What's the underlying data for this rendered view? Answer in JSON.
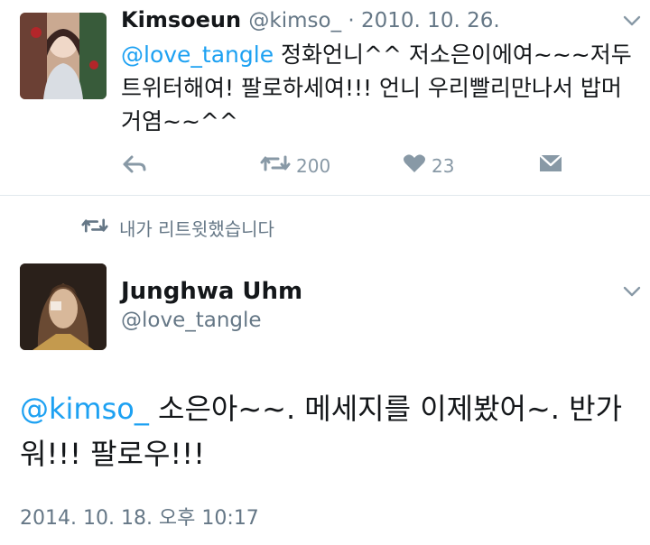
{
  "tweet1": {
    "display_name": "Kimsoeun",
    "handle_date": "@kimso_ · 2010. 10. 26.",
    "mention": "@love_tangle",
    "text": " 정화언니^^ 저소은이에여~~~저두 트위터해여! 팔로하세여!!! 언니 우리빨리만나서 밥머거염~~^^",
    "retweet_count": "200",
    "like_count": "23"
  },
  "retweet_notice": "내가 리트윗했습니다",
  "tweet2": {
    "display_name": "Junghwa Uhm",
    "handle": "@love_tangle",
    "mention": "@kimso_",
    "text": " 소은아~~. 메세지를 이제봤어~. 반가워!!! 팔로우!!!",
    "timestamp": "2014. 10. 18. 오후 10:17"
  },
  "icons": {
    "reply": "reply-icon",
    "retweet": "retweet-icon",
    "like": "heart-icon",
    "dm": "envelope-icon",
    "menu": "chevron-down-icon"
  },
  "colors": {
    "link": "#1da1f2",
    "muted": "#657786",
    "icon": "#8899a6"
  }
}
